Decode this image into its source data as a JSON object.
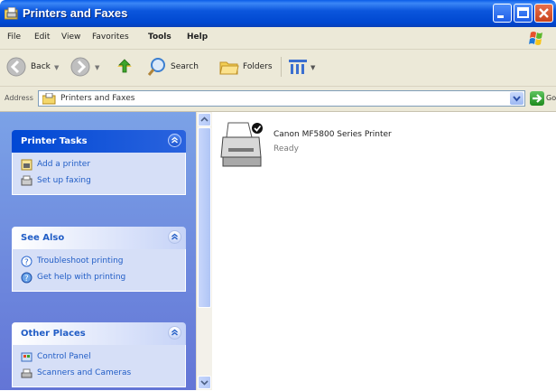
{
  "window": {
    "title": "Printers and Faxes",
    "title_color": "#0054e3",
    "close_color": "#d9522c"
  },
  "menu": {
    "items": [
      "File",
      "Edit",
      "View",
      "Favorites",
      "Tools",
      "Help"
    ]
  },
  "toolbar": {
    "back_label": "Back",
    "search_label": "Search",
    "folders_label": "Folders",
    "icons": {
      "back": "back-arrow-icon",
      "forward": "forward-arrow-icon",
      "up": "up-folder-icon",
      "search": "search-icon",
      "folders": "folders-icon",
      "views": "views-icon"
    }
  },
  "address": {
    "label": "Address",
    "value": "Printers and Faxes",
    "go_label": "Go"
  },
  "taskpane": {
    "printer_tasks": {
      "title": "Printer Tasks",
      "links": [
        "Add a printer",
        "Set up faxing"
      ]
    },
    "see_also": {
      "title": "See Also",
      "links": [
        "Troubleshoot printing",
        "Get help with printing"
      ]
    },
    "other_places": {
      "title": "Other Places",
      "links": [
        "Control Panel",
        "Scanners and Cameras"
      ]
    },
    "link_color": "#215dc6"
  },
  "content": {
    "printer": {
      "name": "Canon MF5800 Series Printer",
      "status": "Ready",
      "is_default": true
    }
  }
}
